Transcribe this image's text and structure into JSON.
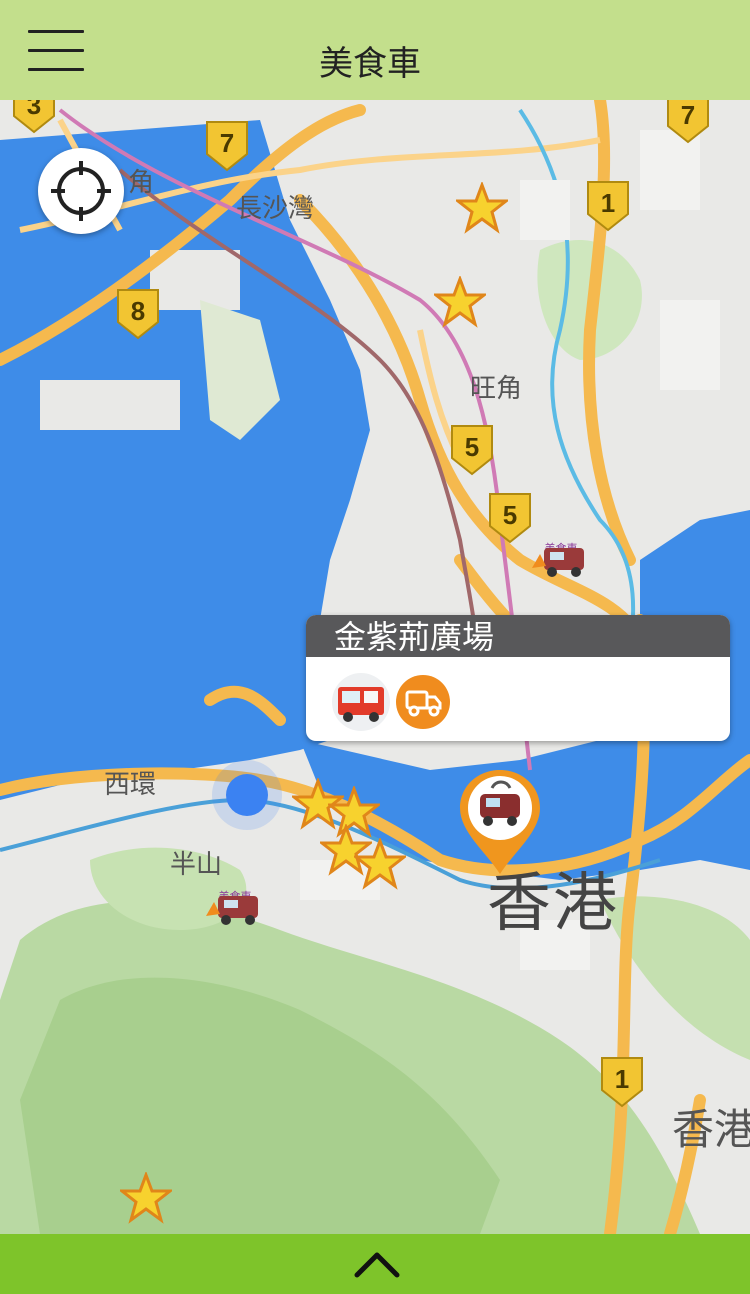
{
  "header": {
    "title": "美食車"
  },
  "map": {
    "place_labels": [
      {
        "id": "mong-kok-partial",
        "text": "角"
      },
      {
        "id": "cheung-sha-wan",
        "text": "長沙灣"
      },
      {
        "id": "hung-hom-partial",
        "text": "旺角"
      },
      {
        "id": "sai-wan",
        "text": "西環"
      },
      {
        "id": "mid-levels",
        "text": "半山"
      },
      {
        "id": "hong-kong",
        "text": "香港"
      },
      {
        "id": "hong-kong-east",
        "text": "香港"
      }
    ],
    "route_shields": [
      "7",
      "7",
      "3",
      "1",
      "8",
      "5",
      "5",
      "1"
    ],
    "marker_logo_text": "美食車"
  },
  "popup": {
    "title": "金紫荊廣場",
    "icon": "truck-icon"
  },
  "colors": {
    "header_bg": "#c3df8c",
    "footer_bg": "#7ec42a",
    "popup_header": "#58585a",
    "accent_orange": "#f08c1e",
    "water": "#3e8ce8",
    "user_dot": "#3b82f2"
  }
}
